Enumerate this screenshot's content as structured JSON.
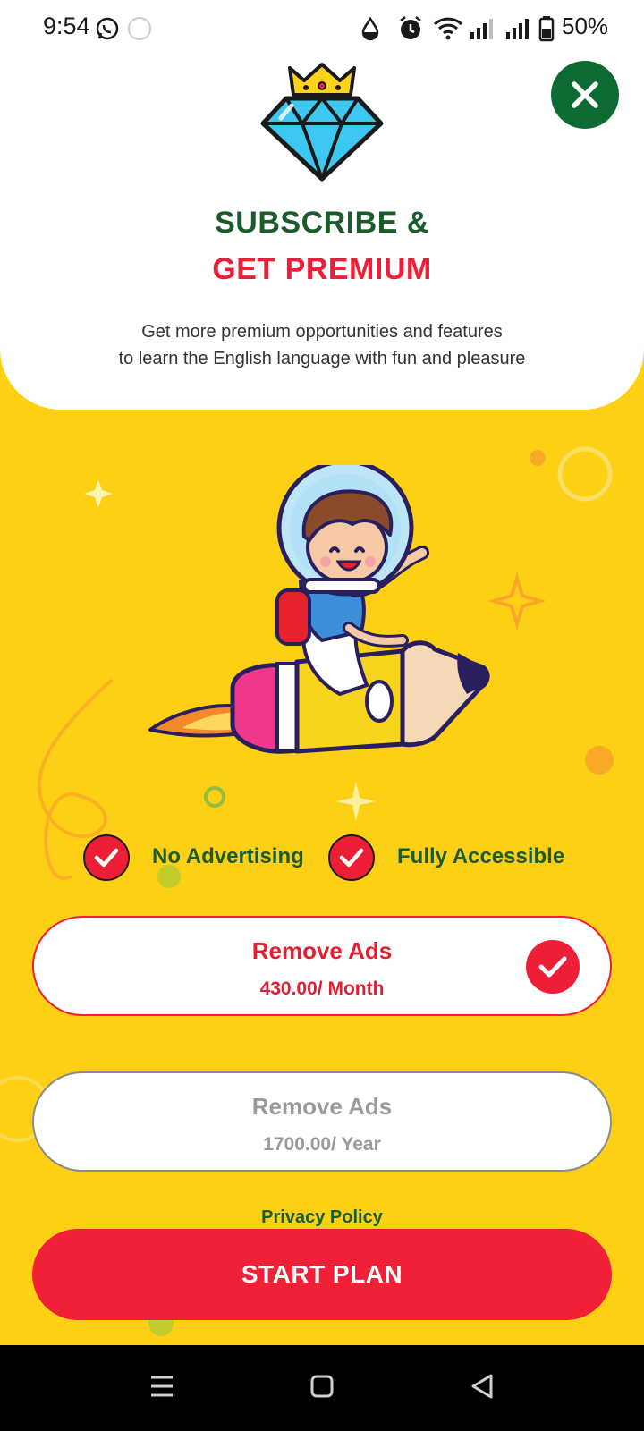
{
  "status_bar": {
    "time": "9:54",
    "battery": "50%",
    "icons": [
      "whatsapp-icon",
      "notification-icon",
      "drop-icon",
      "alarm-icon",
      "wifi-icon",
      "signal-icon",
      "signal-icon",
      "battery-icon"
    ]
  },
  "header": {
    "title_line1": "SUBSCRIBE &",
    "title_line2": "GET PREMIUM",
    "subtitle_line1": "Get more premium opportunities and features",
    "subtitle_line2": "to learn the English language with fun and pleasure"
  },
  "features": [
    {
      "label": "No Advertising"
    },
    {
      "label": "Fully Accessible"
    }
  ],
  "plans": [
    {
      "title": "Remove Ads",
      "price": "430.00/ Month",
      "selected": true
    },
    {
      "title": "Remove Ads",
      "price": "1700.00/ Year",
      "selected": false
    }
  ],
  "privacy_label": "Privacy Policy",
  "start_button": "START PLAN",
  "colors": {
    "background": "#fdd016",
    "green": "#1a5c2e",
    "red": "#ee1e36",
    "close_button": "#0c6b32"
  }
}
